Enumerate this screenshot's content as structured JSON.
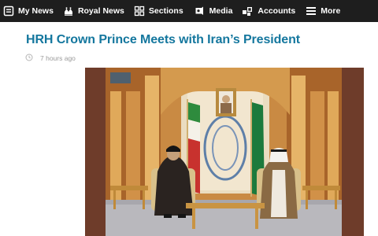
{
  "nav": {
    "items": [
      {
        "label": "My News",
        "icon": "my-news-icon"
      },
      {
        "label": "Royal News",
        "icon": "royal-news-icon"
      },
      {
        "label": "Sections",
        "icon": "sections-grid-icon"
      },
      {
        "label": "Media",
        "icon": "media-icon"
      },
      {
        "label": "Accounts",
        "icon": "accounts-icon"
      },
      {
        "label": "More",
        "icon": "hamburger-menu-icon"
      }
    ]
  },
  "article": {
    "title": "HRH Crown Prince Meets with Iran’s President",
    "timestamp": "7 hours ago",
    "timestamp_icon": "clock-icon",
    "image_badge": "spa-logo"
  },
  "colors": {
    "nav_background": "#1e1e1e",
    "headline": "#14779e",
    "timestamp": "#9a9a9a"
  }
}
